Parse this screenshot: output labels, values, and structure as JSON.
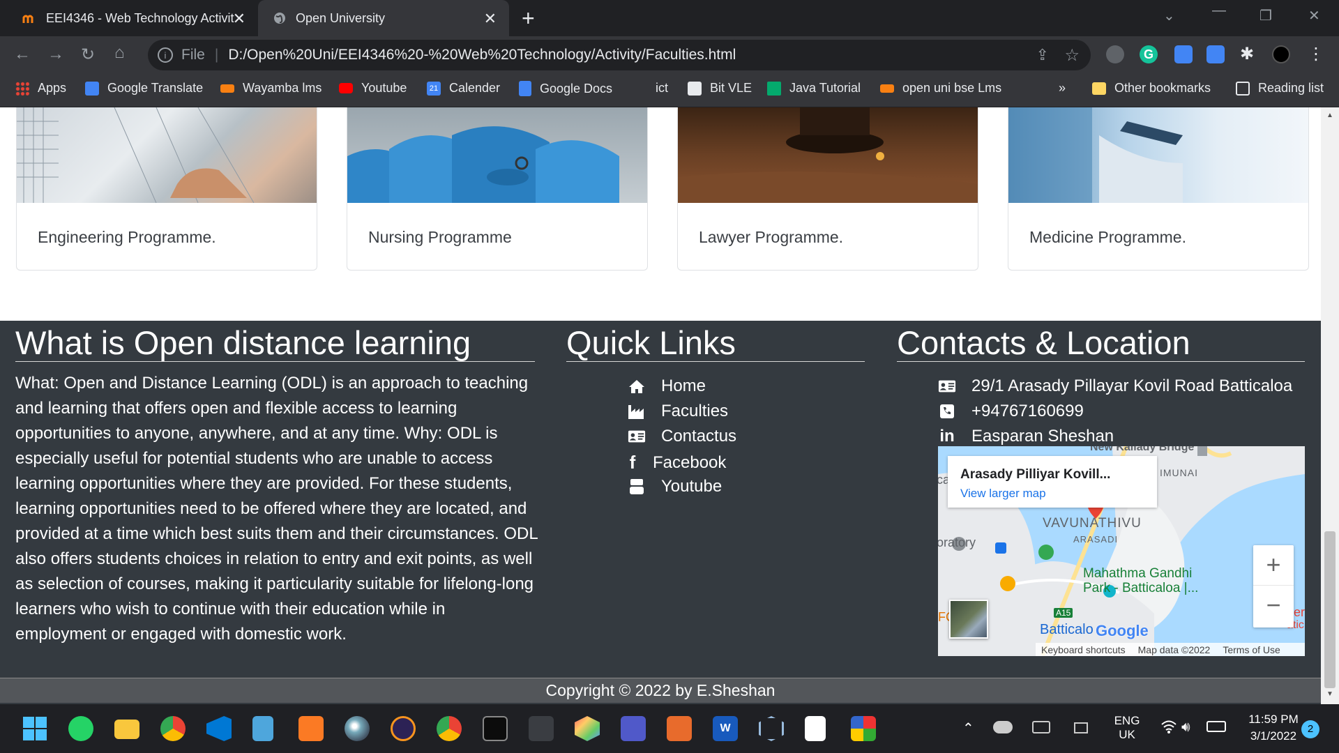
{
  "browser": {
    "tabs": [
      {
        "title": "EEI4346 - Web Technology Activit",
        "active": false
      },
      {
        "title": "Open University",
        "active": true
      }
    ],
    "address": {
      "scheme_label": "File",
      "url": "D:/Open%20Uni/EEI4346%20-%20Web%20Technology/Activity/Faculties.html"
    },
    "bookmarks": [
      {
        "label": "Apps",
        "icon": "apps-grid-icon"
      },
      {
        "label": "Google Translate",
        "icon": "google-translate-icon"
      },
      {
        "label": "Wayamba lms",
        "icon": "moodle-icon"
      },
      {
        "label": "Youtube",
        "icon": "youtube-icon"
      },
      {
        "label": "Calender",
        "icon": "calendar-icon"
      },
      {
        "label": "Google Docs",
        "icon": "google-docs-icon"
      },
      {
        "label": "ict",
        "icon": ""
      },
      {
        "label": "Bit VLE",
        "icon": "bit-vle-icon"
      },
      {
        "label": "Java Tutorial",
        "icon": "w3-icon"
      },
      {
        "label": "open uni bse Lms",
        "icon": "moodle-icon"
      }
    ],
    "more_bookmarks": "»",
    "other_bookmarks": "Other bookmarks",
    "reading_list": "Reading list",
    "calendar_day": "21"
  },
  "cards": [
    {
      "title": "Engineering Programme."
    },
    {
      "title": "Nursing Programme"
    },
    {
      "title": "Lawyer Programme."
    },
    {
      "title": "Medicine Programme."
    }
  ],
  "footer": {
    "odl": {
      "heading": "What is Open distance learning",
      "text": "What: Open and Distance Learning (ODL) is an approach to teaching and learning that offers open and flexible access to learning opportunities to anyone, anywhere, and at any time. Why: ODL is especially useful for potential students who are unable to access learning opportunities where they are provided. For these students, learning opportunities need to be offered where they are located, and provided at a time which best suits them and their circumstances. ODL also offers students choices in relation to entry and exit points, as well as selection of courses, making it particularity suitable for lifelong-long learners who wish to continue with their education while in employment or engaged with domestic work."
    },
    "quick_links": {
      "heading": "Quick Links",
      "items": [
        {
          "label": "Home",
          "icon": "home-icon"
        },
        {
          "label": "Faculties",
          "icon": "industry-icon"
        },
        {
          "label": "Contactus",
          "icon": "address-card-icon"
        },
        {
          "label": "Facebook",
          "icon": "facebook-icon"
        },
        {
          "label": "Youtube",
          "icon": "youtube-icon"
        }
      ]
    },
    "contacts": {
      "heading": "Contacts & Location",
      "address": "29/1 Arasady Pillayar Kovil Road Batticaloa",
      "phone": "+94767160699",
      "linkedin": "Easparan Sheshan"
    },
    "map": {
      "place_name": "Arasady Pilliyar Kovill...",
      "larger_map": "View larger map",
      "labels": {
        "bridge": "New Kallady Bridge",
        "imunai": "IMUNAI",
        "vavunathivu": "VAVUNATHIVU",
        "arasadi": "ARASADI",
        "oratory": "oratory",
        "park": "Mahathma Gandhi Park - Batticaloa |...",
        "kfc": "FC",
        "a15": "A15",
        "batticaloa": "Batticalo",
        "edge_ca": "ca",
        "edge_er": "er",
        "edge_tic": "atic"
      },
      "google": "Google",
      "zoom_in": "+",
      "zoom_out": "−",
      "keyboard_shortcuts": "Keyboard shortcuts",
      "map_data": "Map data ©2022",
      "terms": "Terms of Use"
    },
    "copyright": "Copyright © 2022 by E.Sheshan"
  },
  "taskbar": {
    "language": "ENG",
    "region": "UK",
    "time": "11:59 PM",
    "date": "3/1/2022",
    "notifications": "2"
  },
  "colors": {
    "footer_bg": "#343a40",
    "chrome_bg": "#35363a",
    "tab_strip": "#202124",
    "map_water": "#aadaff",
    "map_pin": "#ea4335",
    "grammarly": "#15c39a"
  }
}
